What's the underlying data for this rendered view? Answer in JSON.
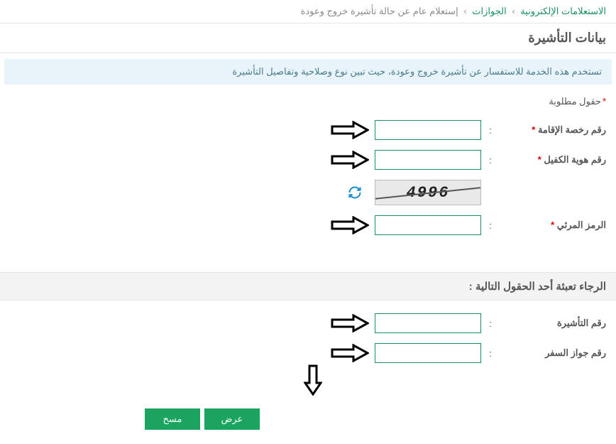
{
  "breadcrumb": {
    "link1": "الاستعلامات الإلكترونية",
    "link2": "الجوازات",
    "current": "إستعلام عام عن حالة تأشيرة خروج وعودة"
  },
  "section_title": "بيانات التأشيرة",
  "info_text": "تستخدم هذه الخدمة للاستفسار عن تأشيرة خروج وعودة، حيث تبين نوع وصلاحية وتفاصيل التأشيرة",
  "required_note": "حقول مطلوبة",
  "fields": {
    "iqama": {
      "label": "رقم رخصة الإقامة",
      "value": ""
    },
    "sponsor": {
      "label": "رقم هوية الكفيل",
      "value": ""
    },
    "captcha_label": "الرمز المرئي",
    "captcha_value": "",
    "captcha_text": "4996",
    "visa": {
      "label": "رقم التأشيرة",
      "value": ""
    },
    "passport": {
      "label": "رقم جواز السفر",
      "value": ""
    }
  },
  "sub_title": "الرجاء تعبئة أحد الحقول التالية :",
  "buttons": {
    "view": "عرض",
    "clear": "مسح"
  }
}
